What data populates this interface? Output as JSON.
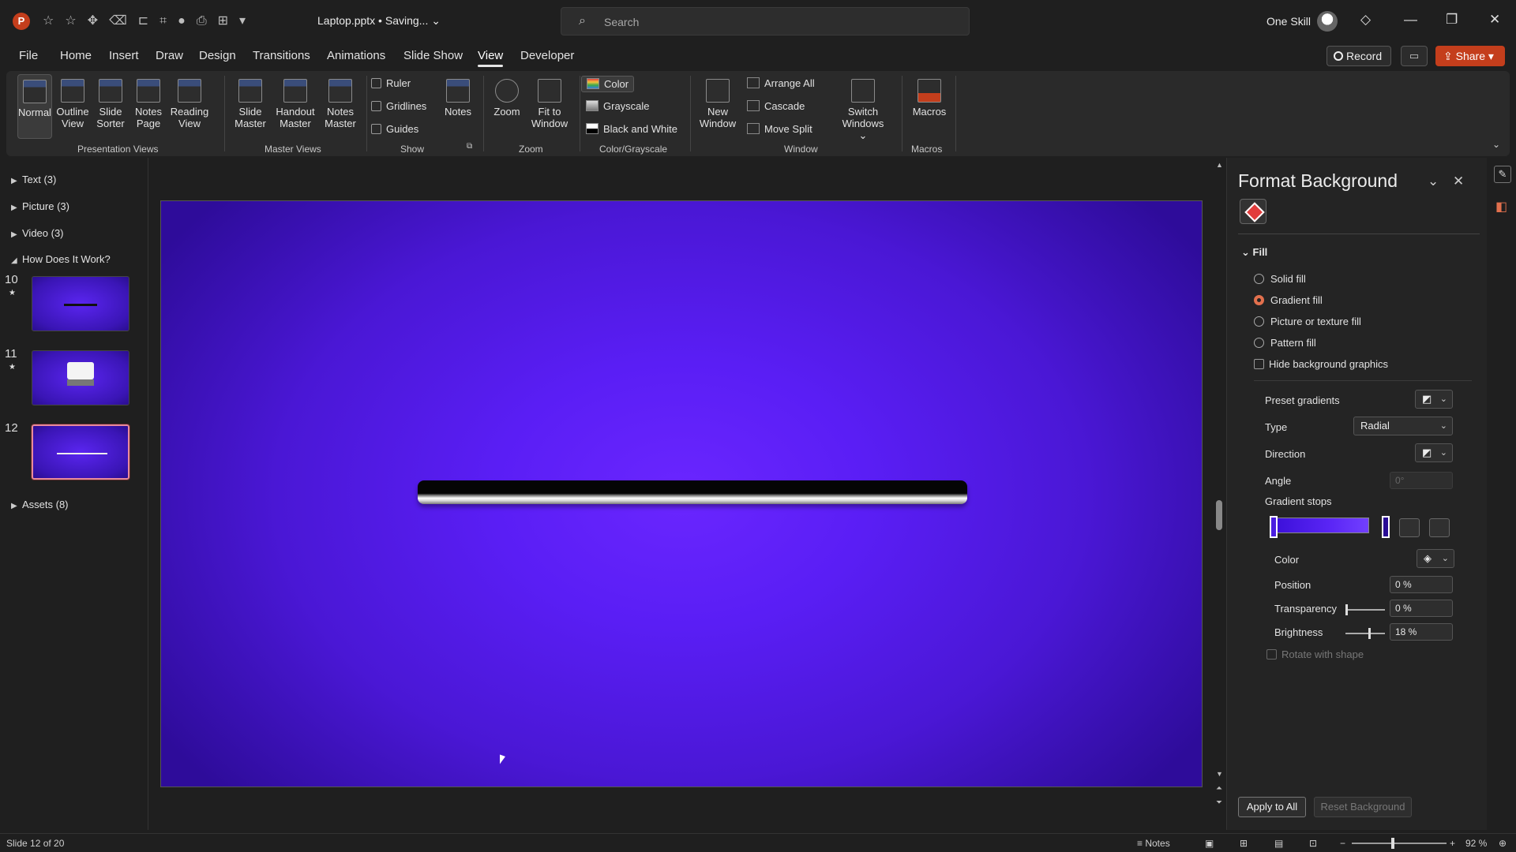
{
  "titlebar": {
    "app_logo": "P",
    "file_title": "Laptop.pptx • Saving...",
    "search_placeholder": "Search",
    "user_name": "One Skill"
  },
  "tabs": [
    "File",
    "Home",
    "Insert",
    "Draw",
    "Design",
    "Transitions",
    "Animations",
    "Slide Show",
    "View",
    "Developer"
  ],
  "active_tab": "View",
  "actions": {
    "record": "Record",
    "share": "Share"
  },
  "ribbon": {
    "presentation_views": {
      "label": "Presentation Views",
      "buttons": [
        [
          "Normal",
          ""
        ],
        [
          "Outline",
          "View"
        ],
        [
          "Slide",
          "Sorter"
        ],
        [
          "Notes",
          "Page"
        ],
        [
          "Reading",
          "View"
        ]
      ]
    },
    "master_views": {
      "label": "Master Views",
      "buttons": [
        [
          "Slide",
          "Master"
        ],
        [
          "Handout",
          "Master"
        ],
        [
          "Notes",
          "Master"
        ]
      ]
    },
    "show": {
      "label": "Show",
      "checks": [
        "Ruler",
        "Gridlines",
        "Guides"
      ],
      "notes": "Notes"
    },
    "zoom": {
      "label": "Zoom",
      "zoom": "Zoom",
      "fit": [
        "Fit to",
        "Window"
      ]
    },
    "color": {
      "label": "Color/Grayscale",
      "items": [
        "Color",
        "Grayscale",
        "Black and White"
      ]
    },
    "window": {
      "label": "Window",
      "new": [
        "New",
        "Window"
      ],
      "items": [
        "Arrange All",
        "Cascade",
        "Move Split"
      ],
      "switch": [
        "Switch",
        "Windows"
      ]
    },
    "macros": {
      "label": "Macros",
      "macros": "Macros"
    }
  },
  "slide_panel": {
    "sections": [
      "Text (3)",
      "Picture (3)",
      "Video (3)",
      "How Does It Work?",
      "Assets (8)"
    ],
    "slides": [
      "10",
      "11",
      "12"
    ]
  },
  "pane": {
    "title": "Format Background",
    "fill_header": "Fill",
    "fill_options": [
      "Solid fill",
      "Gradient fill",
      "Picture or texture fill",
      "Pattern fill"
    ],
    "selected_fill": "Gradient fill",
    "hide_bg": "Hide background graphics",
    "preset_gradients": "Preset gradients",
    "type_label": "Type",
    "type_value": "Radial",
    "direction": "Direction",
    "angle": "Angle",
    "angle_value": "0°",
    "gradient_stops": "Gradient stops",
    "color": "Color",
    "position": "Position",
    "position_value": "0 %",
    "transparency": "Transparency",
    "transparency_value": "0 %",
    "brightness": "Brightness",
    "brightness_value": "18 %",
    "rotate": "Rotate with shape",
    "apply_all": "Apply to All",
    "reset": "Reset Background"
  },
  "status": {
    "slide_of": "Slide 12 of 20",
    "notes": "Notes",
    "zoom": "92 %"
  },
  "colors": {
    "accent": "#c43e1c",
    "slide_center": "#6a26ff",
    "slide_edge": "#2e0c9a"
  }
}
